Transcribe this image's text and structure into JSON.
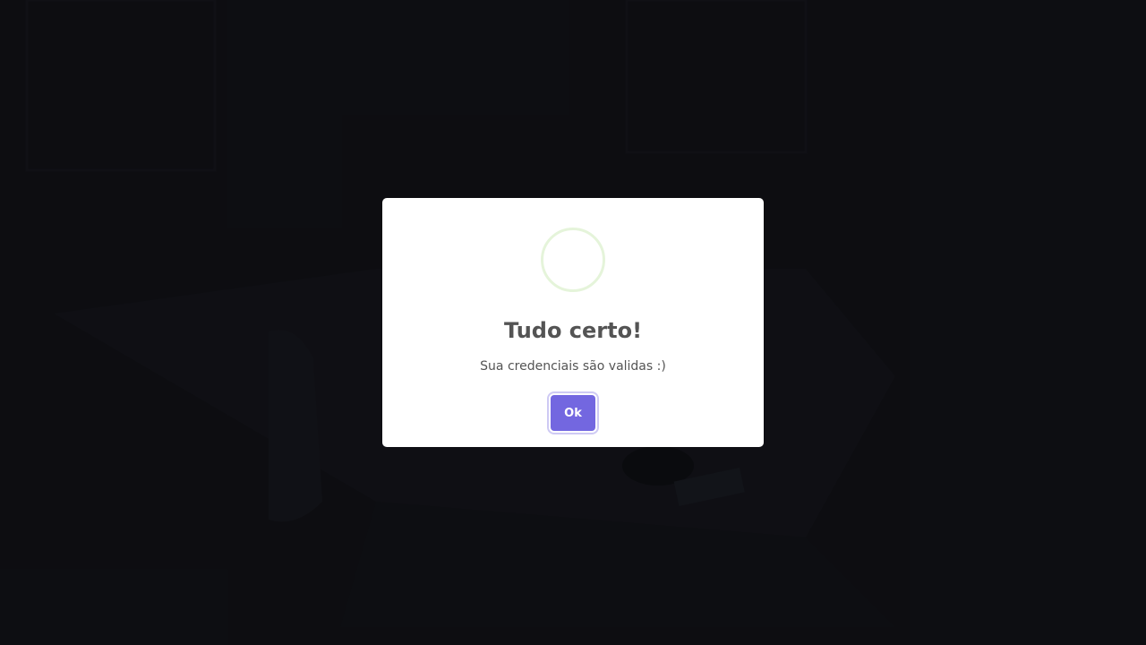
{
  "dialog": {
    "title": "Tudo certo!",
    "message": "Sua credenciais são validas :)",
    "ok_label": "Ok",
    "icon": "success-icon"
  },
  "colors": {
    "button": "#7367e0",
    "icon_ring": "#e5f4da",
    "text": "#545454"
  }
}
